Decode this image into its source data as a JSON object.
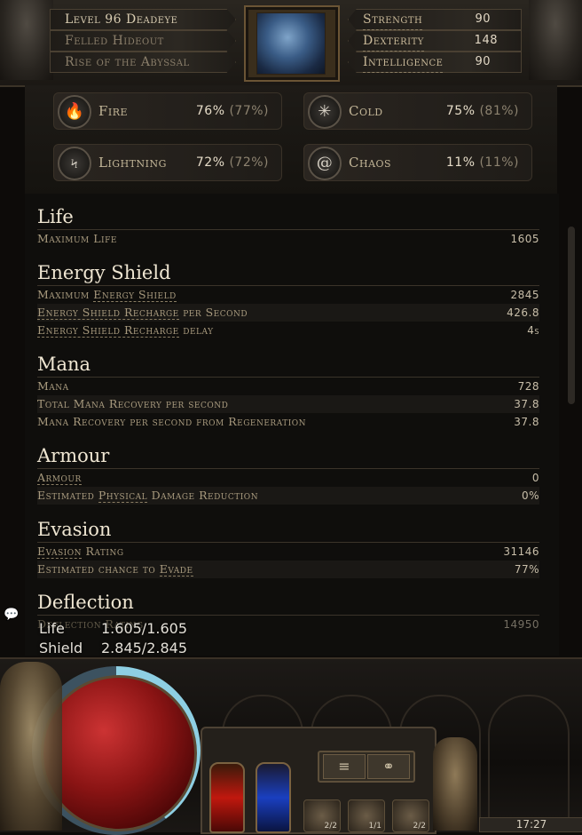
{
  "header": {
    "level_label": "Level 96 Deadeye",
    "location": "Felled Hideout",
    "league": "Rise of the Abyssal League",
    "attributes": [
      {
        "label": "Strength",
        "value": "90"
      },
      {
        "label": "Dexterity",
        "value": "148"
      },
      {
        "label": "Intelligence",
        "value": "90"
      }
    ]
  },
  "resistances": [
    {
      "name": "Fire",
      "value": "76%",
      "max": "(77%)",
      "icon": "fire-icon",
      "glyph": "🔥"
    },
    {
      "name": "Cold",
      "value": "75%",
      "max": "(81%)",
      "icon": "snowflake-icon",
      "glyph": "✳"
    },
    {
      "name": "Lightning",
      "value": "72%",
      "max": "(72%)",
      "icon": "lightning-icon",
      "glyph": "ϟ"
    },
    {
      "name": "Chaos",
      "value": "11%",
      "max": "(11%)",
      "icon": "chaos-spiral-icon",
      "glyph": "@"
    }
  ],
  "sections": {
    "life": {
      "title": "Life",
      "rows": [
        {
          "label": "Maximum Life",
          "value": "1605"
        }
      ]
    },
    "energy_shield": {
      "title": "Energy Shield",
      "rows": [
        {
          "label_a": "Maximum ",
          "label_u": "Energy Shield",
          "label_b": "",
          "value": "2845"
        },
        {
          "label_u": "Energy Shield Recharge",
          "label_b": " per Second",
          "value": "426.8"
        },
        {
          "label_u": "Energy Shield Recharge",
          "label_b": " delay",
          "value": "4s"
        }
      ]
    },
    "mana": {
      "title": "Mana",
      "rows": [
        {
          "label": "Mana",
          "value": "728"
        },
        {
          "label": "Total Mana Recovery per second",
          "value": "37.8"
        },
        {
          "label": "Mana Recovery per second from Regeneration",
          "value": "37.8"
        }
      ]
    },
    "armour": {
      "title": "Armour",
      "rows": [
        {
          "label_u": "Armour",
          "value": "0"
        },
        {
          "label_a": "Estimated ",
          "label_u": "Physical",
          "label_b": " Damage Reduction",
          "value": "0%"
        }
      ]
    },
    "evasion": {
      "title": "Evasion",
      "rows": [
        {
          "label_u": "Evasion",
          "label_b": " Rating",
          "value": "31146"
        },
        {
          "label_a": "Estimated chance to ",
          "label_u": "Evade",
          "value": "77%"
        }
      ]
    },
    "deflection": {
      "title": "Deflection",
      "rows": [
        {
          "label": "Deflection Rating",
          "value": "14950"
        }
      ]
    }
  },
  "overlay": {
    "life_label": "Life",
    "life_value": "1.605/1.605",
    "shield_label": "Shield",
    "shield_value": "2.845/2.845"
  },
  "hud": {
    "belt": [
      "2/2",
      "1/1",
      "2/2"
    ],
    "clock": "17:27",
    "menu_icon": "≡",
    "chain_icon": "⚭"
  },
  "colors": {
    "accent_gold": "#c9b999",
    "life_red": "#8a1414",
    "es_blue": "#8ecfe3"
  }
}
